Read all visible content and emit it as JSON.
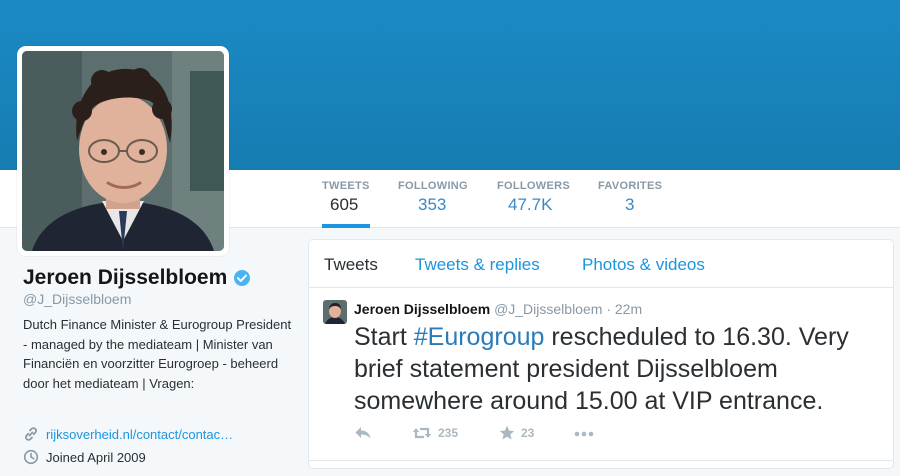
{
  "colors": {
    "banner": "#1b8ac4",
    "link": "#1b95e0",
    "hashtag": "#2b7bb9",
    "verified": "#4ab3f4",
    "muted": "#8899a6"
  },
  "profile": {
    "name": "Jeroen Dijsselbloem",
    "handle": "@J_Dijsselbloem",
    "verified_icon": "verified-badge-icon",
    "bio": "Dutch Finance Minister & Eurogroup President - managed by the mediateam | Minister van Financiën en voorzitter Eurogroep - beheerd door het mediateam | Vragen:",
    "link_icon": "link-icon",
    "link_text": "rijksoverheid.nl/contact/contac…",
    "joined_icon": "clock-icon",
    "joined_text": "Joined April 2009"
  },
  "stats": [
    {
      "label": "TWEETS",
      "value": "605",
      "active": true
    },
    {
      "label": "FOLLOWING",
      "value": "353",
      "active": false
    },
    {
      "label": "FOLLOWERS",
      "value": "47.7K",
      "active": false
    },
    {
      "label": "FAVORITES",
      "value": "3",
      "active": false
    }
  ],
  "timeline": {
    "tabs": [
      {
        "label": "Tweets",
        "active": true
      },
      {
        "label": "Tweets & replies",
        "active": false
      },
      {
        "label": "Photos & videos",
        "active": false
      }
    ]
  },
  "tweet": {
    "author_name": "Jeroen Dijsselbloem",
    "author_handle": "@J_Dijsselbloem",
    "separator": "·",
    "time": "22m",
    "text_start": "Start ",
    "hashtag": "#Eurogroup",
    "text_rest": " rescheduled to 16.30. Very brief statement president Dijsselbloem somewhere around 15.00 at VIP entrance.",
    "actions": {
      "reply_icon": "reply-icon",
      "retweet_icon": "retweet-icon",
      "retweet_count": "235",
      "favorite_icon": "star-icon",
      "favorite_count": "23",
      "more_icon": "more-icon"
    }
  }
}
